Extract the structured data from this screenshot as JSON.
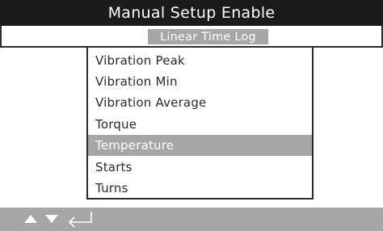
{
  "header": {
    "title": "Manual Setup Enable"
  },
  "subheader": {
    "selected_option": "Linear Time Log"
  },
  "menu": {
    "items": [
      {
        "label": "Vibration Peak",
        "selected": false
      },
      {
        "label": "Vibration Min",
        "selected": false
      },
      {
        "label": "Vibration Average",
        "selected": false
      },
      {
        "label": "Torque",
        "selected": false
      },
      {
        "label": "Temperature",
        "selected": true
      },
      {
        "label": "Starts",
        "selected": false
      },
      {
        "label": "Turns",
        "selected": false
      }
    ]
  },
  "footer": {
    "icons": [
      "arrow-up-icon",
      "arrow-down-icon",
      "enter-return-icon"
    ]
  },
  "colors": {
    "title_bar": "#1a1a1a",
    "highlight": "#a6a6a6",
    "text": "#2a2a2a",
    "background": "#ffffff"
  }
}
